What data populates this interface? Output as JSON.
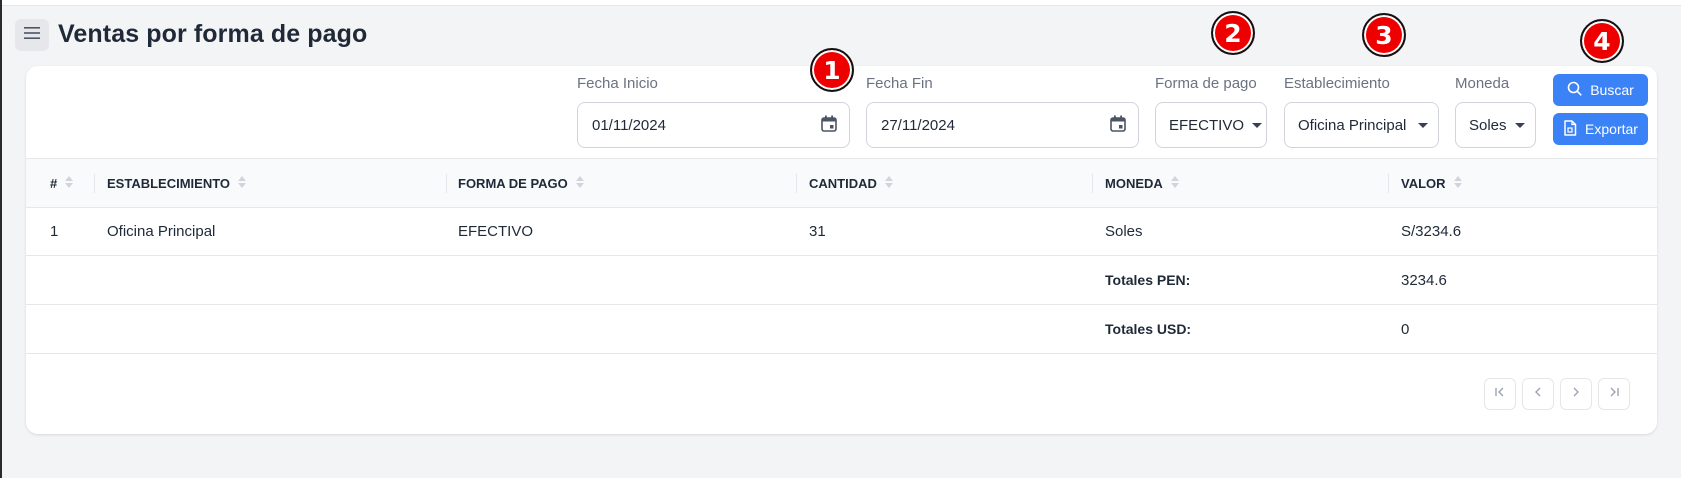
{
  "page": {
    "title": "Ventas por forma de pago"
  },
  "filters": {
    "fecha_inicio": {
      "label": "Fecha Inicio",
      "value": "01/11/2024"
    },
    "fecha_fin": {
      "label": "Fecha Fin",
      "value": "27/11/2024"
    },
    "forma_pago": {
      "label": "Forma de pago",
      "value": "EFECTIVO"
    },
    "establecimiento": {
      "label": "Establecimiento",
      "value": "Oficina Principal"
    },
    "moneda": {
      "label": "Moneda",
      "value": "Soles"
    }
  },
  "buttons": {
    "buscar": "Buscar",
    "exportar": "Exportar"
  },
  "table": {
    "columns": [
      "#",
      "ESTABLECIMIENTO",
      "FORMA DE PAGO",
      "CANTIDAD",
      "MONEDA",
      "VALOR"
    ],
    "rows": [
      {
        "num": "1",
        "establecimiento": "Oficina Principal",
        "forma_pago": "EFECTIVO",
        "cantidad": "31",
        "moneda": "Soles",
        "valor": "S/3234.6"
      }
    ],
    "totals": [
      {
        "label": "Totales PEN:",
        "value": "3234.6"
      },
      {
        "label": "Totales USD:",
        "value": "0"
      }
    ]
  },
  "annotations": [
    "1",
    "2",
    "3",
    "4"
  ],
  "colors": {
    "accent": "#3b82f6",
    "badge": "#ee0000",
    "background": "#f3f4f6"
  },
  "icons": [
    "menu-icon",
    "calendar-icon",
    "chevron-down-icon",
    "search-icon",
    "export-file-icon",
    "sort-icon",
    "first-page-icon",
    "prev-page-icon",
    "next-page-icon",
    "last-page-icon"
  ]
}
